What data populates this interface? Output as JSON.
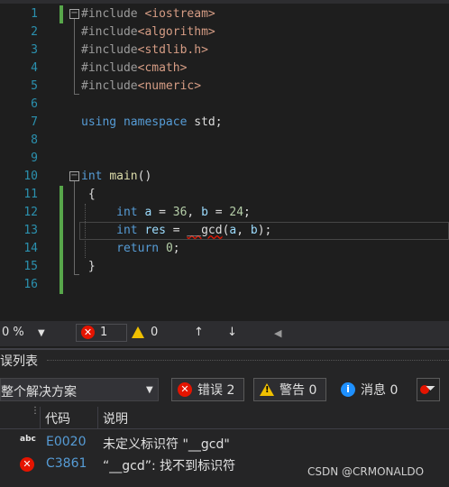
{
  "editor": {
    "lines": [
      {
        "n": "1",
        "html": "<span class='inc'>#include</span> <span class='hdr'>&lt;iostream&gt;</span>"
      },
      {
        "n": "2",
        "html": "<span class='inc'>#include</span><span class='hdr'>&lt;algorithm&gt;</span>"
      },
      {
        "n": "3",
        "html": "<span class='inc'>#include</span><span class='hdr'>&lt;stdlib.h&gt;</span>"
      },
      {
        "n": "4",
        "html": "<span class='inc'>#include</span><span class='hdr'>&lt;cmath&gt;</span>"
      },
      {
        "n": "5",
        "html": "<span class='inc'>#include</span><span class='hdr'>&lt;numeric&gt;</span>"
      },
      {
        "n": "6",
        "html": ""
      },
      {
        "n": "7",
        "html": "<span class='kw'>using</span> <span class='kw'>namespace</span> std;"
      },
      {
        "n": "8",
        "html": ""
      },
      {
        "n": "9",
        "html": ""
      },
      {
        "n": "10",
        "html": "<span class='kw'>int</span> <span class='fn'>main</span>()"
      },
      {
        "n": "11",
        "html": " {"
      },
      {
        "n": "12",
        "html": "     <span class='kw'>int</span> <span class='id'>a</span> = <span class='num'>36</span>, <span class='id'>b</span> = <span class='num'>24</span>;"
      },
      {
        "n": "13",
        "html": "     <span class='kw'>int</span> <span class='id'>res</span> = <span class='gcd'>__gcd</span>(<span class='id'>a</span>, <span class='id'>b</span>);"
      },
      {
        "n": "14",
        "html": "     <span class='kw'>return</span> <span class='num'>0</span>;"
      },
      {
        "n": "15",
        "html": " }"
      },
      {
        "n": "16",
        "html": ""
      }
    ]
  },
  "status": {
    "zoom": "0 %",
    "errors": "1",
    "warnings": "0",
    "up_arrow": "↑",
    "down_arrow": "↓",
    "scroll_left": "◀"
  },
  "error_list": {
    "title": "误列表",
    "scope": "整个解决方案",
    "errors_btn": "错误 2",
    "warnings_btn": "警告 0",
    "messages_btn": "消息 0",
    "col_code": "代码",
    "col_desc": "说明",
    "rows": [
      {
        "icon": "abc",
        "code": "E0020",
        "desc": "未定义标识符 \"__gcd\""
      },
      {
        "icon": "x",
        "code": "C3861",
        "desc": "“__gcd”: 找不到标识符"
      }
    ],
    "watermark": "CSDN @CRMONALDO"
  }
}
